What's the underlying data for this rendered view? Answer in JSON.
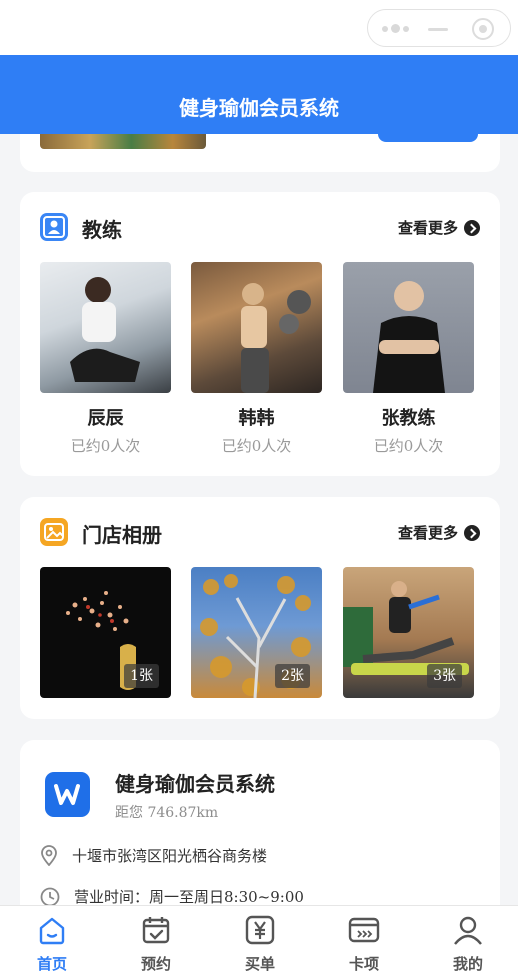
{
  "header": {
    "title": "健身瑜伽会员系统"
  },
  "coaches": {
    "title": "教练",
    "more": "查看更多",
    "items": [
      {
        "name": "辰辰",
        "count": "已约0人次"
      },
      {
        "name": "韩韩",
        "count": "已约0人次"
      },
      {
        "name": "张教练",
        "count": "已约0人次"
      }
    ]
  },
  "album": {
    "title": "门店相册",
    "more": "查看更多",
    "items": [
      {
        "count": "1张"
      },
      {
        "count": "2张"
      },
      {
        "count": "3张"
      }
    ]
  },
  "store": {
    "name": "健身瑜伽会员系统",
    "distance": "距您 746.87km",
    "address": "十堰市张湾区阳光栖谷商务楼",
    "hours": "营业时间：周一至周日8:30~9:00"
  },
  "tabbar": {
    "items": [
      {
        "label": "首页",
        "icon": "home-icon",
        "active": true
      },
      {
        "label": "预约",
        "icon": "calendar-check-icon",
        "active": false
      },
      {
        "label": "买单",
        "icon": "yen-pay-icon",
        "active": false
      },
      {
        "label": "卡项",
        "icon": "card-icon",
        "active": false
      },
      {
        "label": "我的",
        "icon": "user-icon",
        "active": false
      }
    ]
  },
  "colors": {
    "primary": "#2f7ef5",
    "accent_orange": "#f5a623",
    "text": "#222222",
    "muted": "#9a9a9a"
  }
}
